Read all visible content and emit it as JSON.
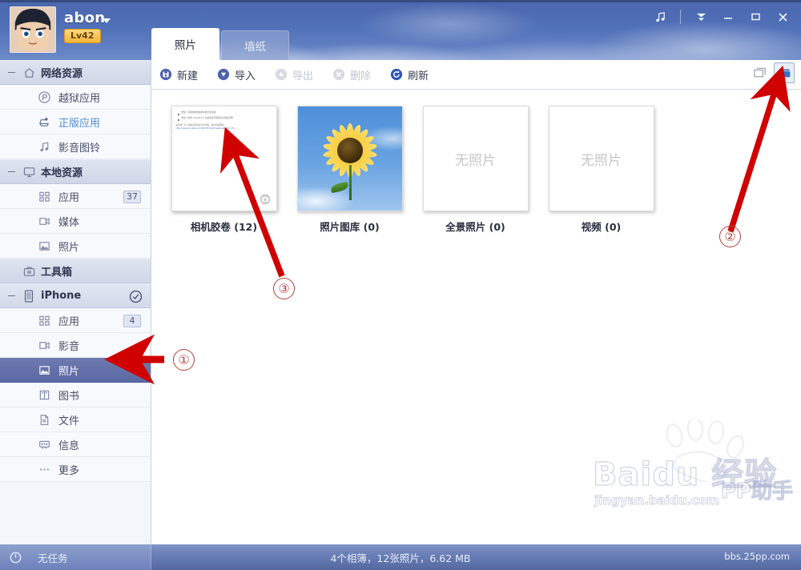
{
  "titlebar": {
    "username": "abon",
    "level_badge": "Lv42",
    "avatar_name": "user-avatar",
    "buttons": [
      {
        "name": "music-icon",
        "label": "♫"
      },
      {
        "name": "more-menu-icon",
        "label": "▼"
      },
      {
        "name": "minimize-button",
        "label": "–"
      },
      {
        "name": "maximize-button",
        "label": "□"
      },
      {
        "name": "close-button",
        "label": "✕"
      }
    ]
  },
  "sidebar": {
    "groups": [
      {
        "label": "网络资源",
        "icon": "home-icon",
        "items": [
          {
            "label": "越狱应用",
            "icon": "pp-icon",
            "badge": "",
            "state": "normal"
          },
          {
            "label": "正版应用",
            "icon": "apple-store-icon",
            "badge": "",
            "state": "link"
          },
          {
            "label": "影音图铃",
            "icon": "music-note-icon",
            "badge": "",
            "state": "normal"
          }
        ]
      },
      {
        "label": "本地资源",
        "icon": "monitor-icon",
        "items": [
          {
            "label": "应用",
            "icon": "apps-grid-icon",
            "badge": "37",
            "state": "normal"
          },
          {
            "label": "媒体",
            "icon": "media-icon",
            "badge": "",
            "state": "normal"
          },
          {
            "label": "照片",
            "icon": "photo-icon",
            "badge": "",
            "state": "normal"
          }
        ]
      }
    ],
    "toolbox": {
      "label": "工具箱",
      "icon": "toolbox-icon"
    },
    "device": {
      "label": "iPhone",
      "icon": "iphone-icon",
      "status_icon": "connected-check-icon",
      "items": [
        {
          "label": "应用",
          "icon": "apps-grid-icon",
          "badge": "4",
          "state": "normal"
        },
        {
          "label": "影音",
          "icon": "media-icon",
          "badge": "",
          "state": "normal"
        },
        {
          "label": "照片",
          "icon": "photo-icon",
          "badge": "",
          "state": "selected"
        },
        {
          "label": "图书",
          "icon": "book-icon",
          "badge": "",
          "state": "normal"
        },
        {
          "label": "文件",
          "icon": "file-icon",
          "badge": "",
          "state": "normal"
        },
        {
          "label": "信息",
          "icon": "message-icon",
          "badge": "",
          "state": "normal"
        },
        {
          "label": "更多",
          "icon": "more-dots-icon",
          "badge": "",
          "state": "normal"
        }
      ]
    }
  },
  "tabs": [
    {
      "label": "照片",
      "active": true
    },
    {
      "label": "墙纸",
      "active": false
    }
  ],
  "toolbar": {
    "items": [
      {
        "label": "新建",
        "icon": "new-album-icon",
        "disabled": false
      },
      {
        "label": "导入",
        "icon": "import-icon",
        "disabled": false
      },
      {
        "label": "导出",
        "icon": "export-icon",
        "disabled": true
      },
      {
        "label": "删除",
        "icon": "delete-icon",
        "disabled": true
      },
      {
        "label": "刷新",
        "icon": "refresh-icon",
        "disabled": false
      }
    ],
    "view_modes": [
      {
        "name": "list-view-button",
        "selected": false
      },
      {
        "name": "album-view-button",
        "selected": true
      }
    ]
  },
  "albums": [
    {
      "label": "相机胶卷 (12)",
      "thumb_type": "screenshot",
      "screenshot_lines": [
        "修复了可能影响键盘响应能力的错误",
        "修复了启用 VoiceOver 后使用蓝牙键盘对出现的问题"
      ],
      "screenshot_para": "如需进一步了解本更新的安全性内容，请访问此网站：",
      "screenshot_link": "http://support.apple.com/kb/HT1222?viewlocale=zh_CN"
    },
    {
      "label": "照片图库 (0)",
      "thumb_type": "sunflower"
    },
    {
      "label": "全景照片 (0)",
      "thumb_type": "empty",
      "empty_text": "无照片"
    },
    {
      "label": "视频 (0)",
      "thumb_type": "empty",
      "empty_text": "无照片"
    }
  ],
  "status": {
    "task_label": "无任务",
    "summary": "4个相簿，12张照片，6.62 MB",
    "site": "bbs.25pp.com",
    "power_icon": "power-icon"
  },
  "watermark": {
    "brand": "Baidu 经验",
    "url": "jingyan.baidu.com",
    "product": "PP助手"
  },
  "annotations": [
    {
      "num": "①",
      "target": "sidebar-photos"
    },
    {
      "num": "②",
      "target": "album-view-button"
    },
    {
      "num": "③",
      "target": "camera-roll-album"
    }
  ],
  "colors": {
    "accent": "#5b68a4",
    "titlebar": "#4a66ae",
    "annotation": "#d00000",
    "link": "#4e8fd6"
  }
}
